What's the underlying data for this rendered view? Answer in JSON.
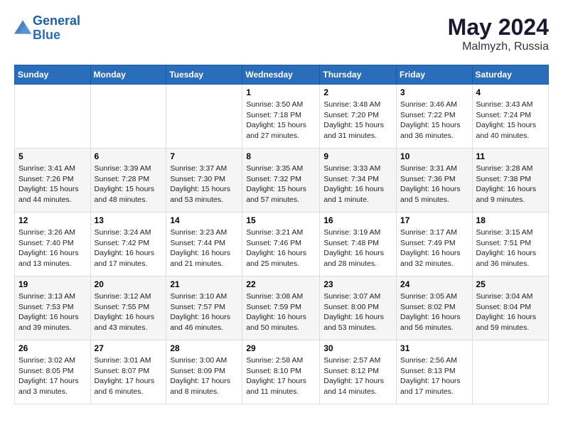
{
  "header": {
    "logo_line1": "General",
    "logo_line2": "Blue",
    "month_year": "May 2024",
    "location": "Malmyzh, Russia"
  },
  "weekdays": [
    "Sunday",
    "Monday",
    "Tuesday",
    "Wednesday",
    "Thursday",
    "Friday",
    "Saturday"
  ],
  "weeks": [
    [
      {
        "day": "",
        "info": ""
      },
      {
        "day": "",
        "info": ""
      },
      {
        "day": "",
        "info": ""
      },
      {
        "day": "1",
        "info": "Sunrise: 3:50 AM\nSunset: 7:18 PM\nDaylight: 15 hours\nand 27 minutes."
      },
      {
        "day": "2",
        "info": "Sunrise: 3:48 AM\nSunset: 7:20 PM\nDaylight: 15 hours\nand 31 minutes."
      },
      {
        "day": "3",
        "info": "Sunrise: 3:46 AM\nSunset: 7:22 PM\nDaylight: 15 hours\nand 36 minutes."
      },
      {
        "day": "4",
        "info": "Sunrise: 3:43 AM\nSunset: 7:24 PM\nDaylight: 15 hours\nand 40 minutes."
      }
    ],
    [
      {
        "day": "5",
        "info": "Sunrise: 3:41 AM\nSunset: 7:26 PM\nDaylight: 15 hours\nand 44 minutes."
      },
      {
        "day": "6",
        "info": "Sunrise: 3:39 AM\nSunset: 7:28 PM\nDaylight: 15 hours\nand 48 minutes."
      },
      {
        "day": "7",
        "info": "Sunrise: 3:37 AM\nSunset: 7:30 PM\nDaylight: 15 hours\nand 53 minutes."
      },
      {
        "day": "8",
        "info": "Sunrise: 3:35 AM\nSunset: 7:32 PM\nDaylight: 15 hours\nand 57 minutes."
      },
      {
        "day": "9",
        "info": "Sunrise: 3:33 AM\nSunset: 7:34 PM\nDaylight: 16 hours\nand 1 minute."
      },
      {
        "day": "10",
        "info": "Sunrise: 3:31 AM\nSunset: 7:36 PM\nDaylight: 16 hours\nand 5 minutes."
      },
      {
        "day": "11",
        "info": "Sunrise: 3:28 AM\nSunset: 7:38 PM\nDaylight: 16 hours\nand 9 minutes."
      }
    ],
    [
      {
        "day": "12",
        "info": "Sunrise: 3:26 AM\nSunset: 7:40 PM\nDaylight: 16 hours\nand 13 minutes."
      },
      {
        "day": "13",
        "info": "Sunrise: 3:24 AM\nSunset: 7:42 PM\nDaylight: 16 hours\nand 17 minutes."
      },
      {
        "day": "14",
        "info": "Sunrise: 3:23 AM\nSunset: 7:44 PM\nDaylight: 16 hours\nand 21 minutes."
      },
      {
        "day": "15",
        "info": "Sunrise: 3:21 AM\nSunset: 7:46 PM\nDaylight: 16 hours\nand 25 minutes."
      },
      {
        "day": "16",
        "info": "Sunrise: 3:19 AM\nSunset: 7:48 PM\nDaylight: 16 hours\nand 28 minutes."
      },
      {
        "day": "17",
        "info": "Sunrise: 3:17 AM\nSunset: 7:49 PM\nDaylight: 16 hours\nand 32 minutes."
      },
      {
        "day": "18",
        "info": "Sunrise: 3:15 AM\nSunset: 7:51 PM\nDaylight: 16 hours\nand 36 minutes."
      }
    ],
    [
      {
        "day": "19",
        "info": "Sunrise: 3:13 AM\nSunset: 7:53 PM\nDaylight: 16 hours\nand 39 minutes."
      },
      {
        "day": "20",
        "info": "Sunrise: 3:12 AM\nSunset: 7:55 PM\nDaylight: 16 hours\nand 43 minutes."
      },
      {
        "day": "21",
        "info": "Sunrise: 3:10 AM\nSunset: 7:57 PM\nDaylight: 16 hours\nand 46 minutes."
      },
      {
        "day": "22",
        "info": "Sunrise: 3:08 AM\nSunset: 7:59 PM\nDaylight: 16 hours\nand 50 minutes."
      },
      {
        "day": "23",
        "info": "Sunrise: 3:07 AM\nSunset: 8:00 PM\nDaylight: 16 hours\nand 53 minutes."
      },
      {
        "day": "24",
        "info": "Sunrise: 3:05 AM\nSunset: 8:02 PM\nDaylight: 16 hours\nand 56 minutes."
      },
      {
        "day": "25",
        "info": "Sunrise: 3:04 AM\nSunset: 8:04 PM\nDaylight: 16 hours\nand 59 minutes."
      }
    ],
    [
      {
        "day": "26",
        "info": "Sunrise: 3:02 AM\nSunset: 8:05 PM\nDaylight: 17 hours\nand 3 minutes."
      },
      {
        "day": "27",
        "info": "Sunrise: 3:01 AM\nSunset: 8:07 PM\nDaylight: 17 hours\nand 6 minutes."
      },
      {
        "day": "28",
        "info": "Sunrise: 3:00 AM\nSunset: 8:09 PM\nDaylight: 17 hours\nand 8 minutes."
      },
      {
        "day": "29",
        "info": "Sunrise: 2:58 AM\nSunset: 8:10 PM\nDaylight: 17 hours\nand 11 minutes."
      },
      {
        "day": "30",
        "info": "Sunrise: 2:57 AM\nSunset: 8:12 PM\nDaylight: 17 hours\nand 14 minutes."
      },
      {
        "day": "31",
        "info": "Sunrise: 2:56 AM\nSunset: 8:13 PM\nDaylight: 17 hours\nand 17 minutes."
      },
      {
        "day": "",
        "info": ""
      }
    ]
  ]
}
